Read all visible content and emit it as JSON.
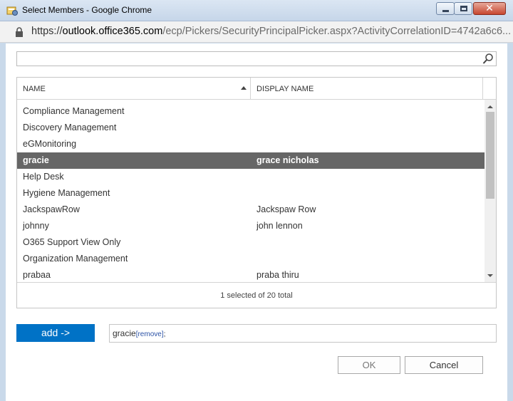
{
  "window": {
    "title": "Select Members - Google Chrome",
    "url_prefix": "https://",
    "url_host": "outlook.office365.com",
    "url_path": "/ecp/Pickers/SecurityPrincipalPicker.aspx?ActivityCorrelationID=4742a6c6..."
  },
  "search": {
    "value": "",
    "placeholder": ""
  },
  "grid": {
    "columns": [
      "NAME",
      "DISPLAY NAME"
    ],
    "rows": [
      {
        "name": "Compliance Management",
        "display": "",
        "selected": false
      },
      {
        "name": "Discovery Management",
        "display": "",
        "selected": false
      },
      {
        "name": "eGMonitoring",
        "display": "",
        "selected": false
      },
      {
        "name": "gracie",
        "display": "grace nicholas",
        "selected": true
      },
      {
        "name": "Help Desk",
        "display": "",
        "selected": false
      },
      {
        "name": "Hygiene Management",
        "display": "",
        "selected": false
      },
      {
        "name": "JackspawRow",
        "display": "Jackspaw Row",
        "selected": false
      },
      {
        "name": "johnny",
        "display": "john lennon",
        "selected": false
      },
      {
        "name": "O365 Support View Only",
        "display": "",
        "selected": false
      },
      {
        "name": "Organization Management",
        "display": "",
        "selected": false
      },
      {
        "name": "prabaa",
        "display": "praba thiru",
        "selected": false
      }
    ],
    "status": "1 selected of 20 total"
  },
  "picker": {
    "add_label": "add ->",
    "selected_name": "gracie",
    "remove_label": "[remove]",
    "separator": ";"
  },
  "buttons": {
    "ok": "OK",
    "cancel": "Cancel"
  },
  "colors": {
    "accent": "#0072c6",
    "selected_row": "#666666"
  }
}
